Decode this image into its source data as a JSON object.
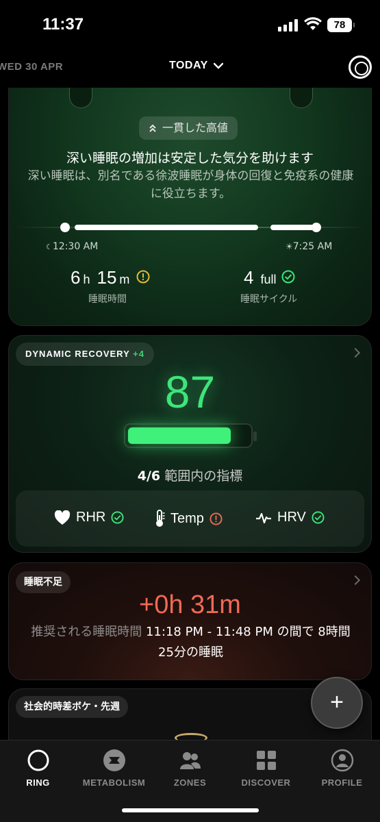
{
  "status_bar": {
    "time": "11:37",
    "battery": "78"
  },
  "header": {
    "prev_date": "WED 30 APR",
    "current_label": "TODAY"
  },
  "sleep_card": {
    "badge": "一貫した高値",
    "title": "深い睡眠の増加は安定した気分を助けます",
    "description": "深い睡眠は、別名である徐波睡眠が身体の回復と免疫系の健康に役立ちます。",
    "bedtime": "12:30 AM",
    "waketime": "7:25 AM",
    "duration_h": "6",
    "duration_h_unit": "h",
    "duration_m": "15",
    "duration_m_unit": "m",
    "duration_label": "睡眠時間",
    "cycles_value": "4",
    "cycles_unit": "full",
    "cycles_label": "睡眠サイクル"
  },
  "recovery_card": {
    "label": "DYNAMIC RECOVERY",
    "delta": "+4",
    "score": "87",
    "score_fraction": 0.87,
    "range_count": "4/6",
    "range_text": "範囲内の指標",
    "metrics": [
      {
        "name": "RHR",
        "icon": "heart-icon",
        "status": "ok"
      },
      {
        "name": "Temp",
        "icon": "thermometer-icon",
        "status": "warning"
      },
      {
        "name": "HRV",
        "icon": "pulse-icon",
        "status": "ok"
      }
    ]
  },
  "deficit_card": {
    "label": "睡眠不足",
    "value": "+0h 31m",
    "desc_prefix": "推奨される睡眠時間 ",
    "desc_range": "11:18 PM - 11:48 PM の間で 8時間 25分の睡眠"
  },
  "social_card": {
    "label": "社会的時差ボケ・先週"
  },
  "fab": {
    "label": "+"
  },
  "tabs": [
    {
      "label": "RING",
      "icon": "ring-icon",
      "active": true
    },
    {
      "label": "METABOLISM",
      "icon": "metabolism-icon",
      "active": false
    },
    {
      "label": "ZONES",
      "icon": "zones-icon",
      "active": false
    },
    {
      "label": "DISCOVER",
      "icon": "discover-icon",
      "active": false
    },
    {
      "label": "PROFILE",
      "icon": "profile-icon",
      "active": false
    }
  ],
  "colors": {
    "accent_green": "#3ee57a",
    "warning_yellow": "#e3b93a",
    "alert_red": "#f06a55"
  }
}
